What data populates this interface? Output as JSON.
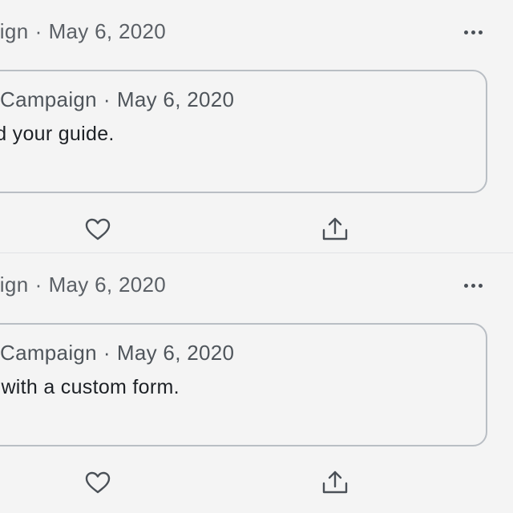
{
  "tweets": [
    {
      "header_handle": "paign",
      "header_date": "May 6, 2020",
      "quote": {
        "header_handle": "Campaign",
        "header_date": "May 6, 2020",
        "body": "ad your guide."
      },
      "icons": {
        "more": "more-dots-icon",
        "like": "heart-icon",
        "share": "share-upload-icon"
      }
    },
    {
      "header_handle": "paign",
      "header_date": "May 6, 2020",
      "quote": {
        "header_handle": "Campaign",
        "header_date": "May 6, 2020",
        "body": "o with a custom form."
      },
      "icons": {
        "more": "more-dots-icon",
        "like": "heart-icon",
        "share": "share-upload-icon"
      }
    }
  ],
  "separator": "·",
  "colors": {
    "background": "#f4f4f4",
    "muted_text": "#5b6066",
    "body_text": "#1d2126",
    "card_border": "#b9bec4",
    "icon": "#4a5057"
  }
}
